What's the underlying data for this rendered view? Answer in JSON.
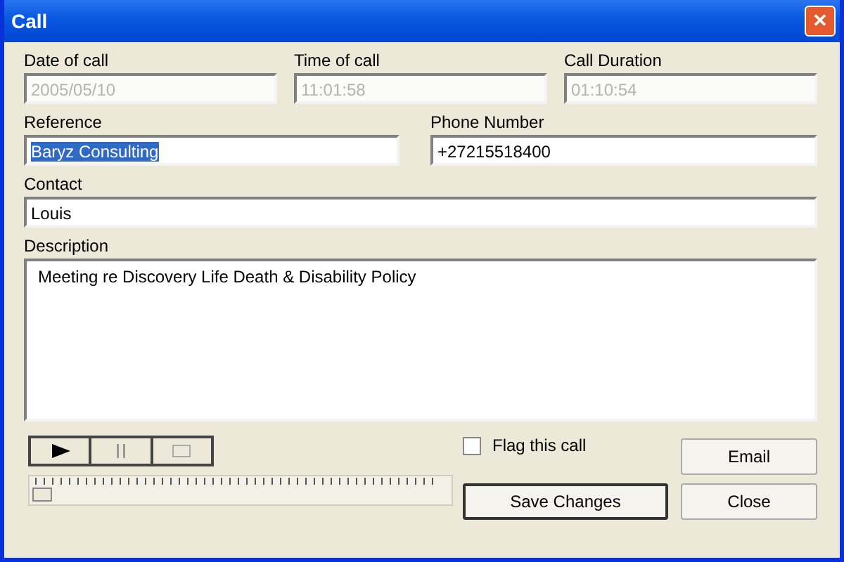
{
  "window": {
    "title": "Call",
    "close_glyph": "✕"
  },
  "top_fields": [
    {
      "label": "Date of call",
      "value": "2005/05/10",
      "disabled": true,
      "highlighted": false
    },
    {
      "label": "Time of call",
      "value": "11:01:58",
      "disabled": true,
      "highlighted": false
    },
    {
      "label": "Call Duration",
      "value": "01:10:54",
      "disabled": true,
      "highlighted": false
    }
  ],
  "mid_fields": [
    {
      "label": "Reference",
      "value": "Baryz Consulting",
      "disabled": false,
      "highlighted": true
    },
    {
      "label": "Phone Number",
      "value": "+27215518400",
      "disabled": false,
      "highlighted": false
    }
  ],
  "contact": {
    "label": "Contact",
    "value": "Louis",
    "disabled": false,
    "highlighted": false
  },
  "description": {
    "label": "Description",
    "value": "Meeting re Discovery Life Death & Disability Policy"
  },
  "media_buttons": [
    {
      "kind": "play",
      "disabled": false
    },
    {
      "kind": "pause",
      "disabled": true
    },
    {
      "kind": "stop",
      "disabled": true
    }
  ],
  "position_slider": {
    "level": 0
  },
  "flag": {
    "label": "Flag this call",
    "checked": false
  },
  "buttons": [
    {
      "label": "Email",
      "default": false
    },
    {
      "label": "Save Changes",
      "default": true
    },
    {
      "label": "Close",
      "default": false
    }
  ]
}
